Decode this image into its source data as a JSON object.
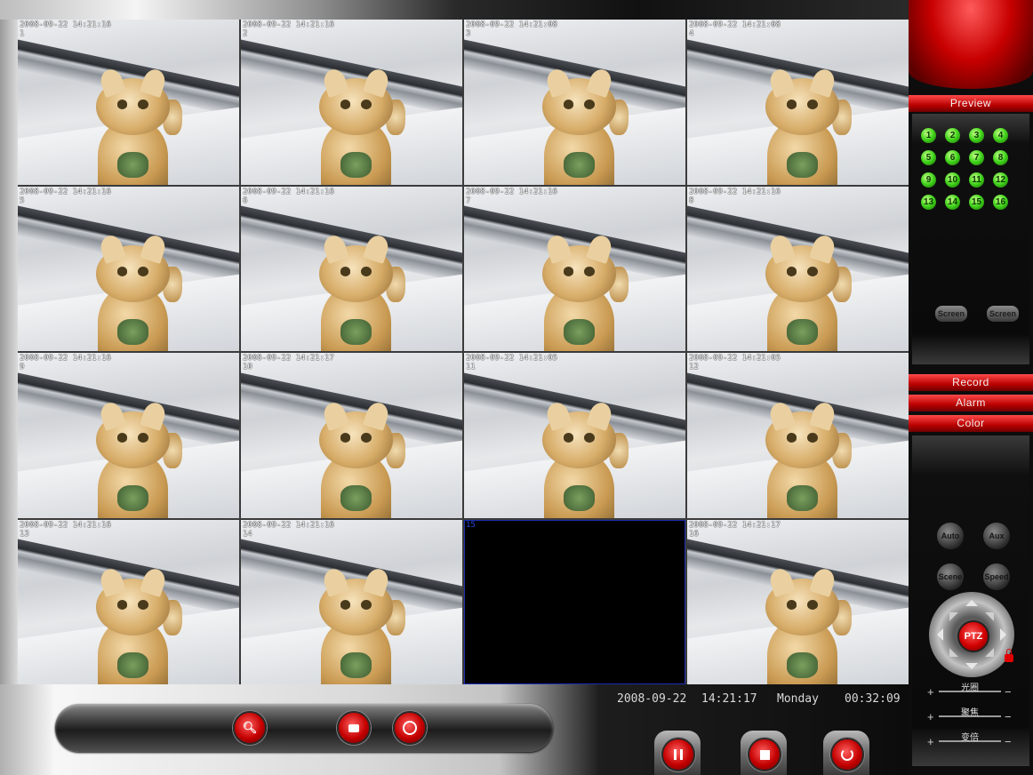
{
  "tiles": [
    {
      "stamp": "2008-09-22 14:21:16",
      "num": "1",
      "live": true
    },
    {
      "stamp": "2008-09-22 14:21:16",
      "num": "2",
      "live": true
    },
    {
      "stamp": "2008-09-22 14:21:08",
      "num": "3",
      "live": true
    },
    {
      "stamp": "2008-09-22 14:21:08",
      "num": "4",
      "live": true
    },
    {
      "stamp": "2008-09-22 14:21:16",
      "num": "5",
      "live": true
    },
    {
      "stamp": "2008-09-22 14:21:16",
      "num": "6",
      "live": true
    },
    {
      "stamp": "2008-09-22 14:21:16",
      "num": "7",
      "live": true
    },
    {
      "stamp": "2008-09-22 14:21:16",
      "num": "8",
      "live": true
    },
    {
      "stamp": "2008-09-22 14:21:16",
      "num": "9",
      "live": true
    },
    {
      "stamp": "2008-09-22 14:21:17",
      "num": "10",
      "live": true
    },
    {
      "stamp": "2008-09-22 14:21:05",
      "num": "11",
      "live": true
    },
    {
      "stamp": "2008-09-22 14:21:05",
      "num": "12",
      "live": true
    },
    {
      "stamp": "2008-09-22 14:21:16",
      "num": "13",
      "live": true
    },
    {
      "stamp": "2008-09-22 14:21:16",
      "num": "14",
      "live": true
    },
    {
      "stamp": "15",
      "num": "",
      "live": false
    },
    {
      "stamp": "2008-09-22 14:21:17",
      "num": "16",
      "live": true
    }
  ],
  "status": {
    "date": "2008-09-22",
    "time": "14:21:17",
    "weekday": "Monday",
    "elapsed": "00:32:09"
  },
  "side": {
    "preview_tab": "Preview",
    "record_tab": "Record",
    "alarm_tab": "Alarm",
    "color_tab": "Color",
    "channels": [
      "1",
      "2",
      "3",
      "4",
      "5",
      "6",
      "7",
      "8",
      "9",
      "10",
      "11",
      "12",
      "13",
      "14",
      "15",
      "16"
    ],
    "screen_on": "Screen",
    "screen_off": "Screen",
    "auto": "Auto",
    "aux": "Aux",
    "scene": "Scene",
    "speed": "Speed",
    "ptz": "PTZ",
    "iris": "光圈",
    "focus": "聚焦",
    "zoom": "变倍"
  },
  "colors": {
    "accent_red": "#c80000",
    "channel_green": "#3fd21a"
  },
  "icons": {
    "search": "search-icon",
    "snapshot": "camera-icon",
    "record": "record-circle-icon",
    "pause": "pause-icon",
    "stop": "stop-icon",
    "power": "power-icon",
    "lock": "lock-icon"
  }
}
